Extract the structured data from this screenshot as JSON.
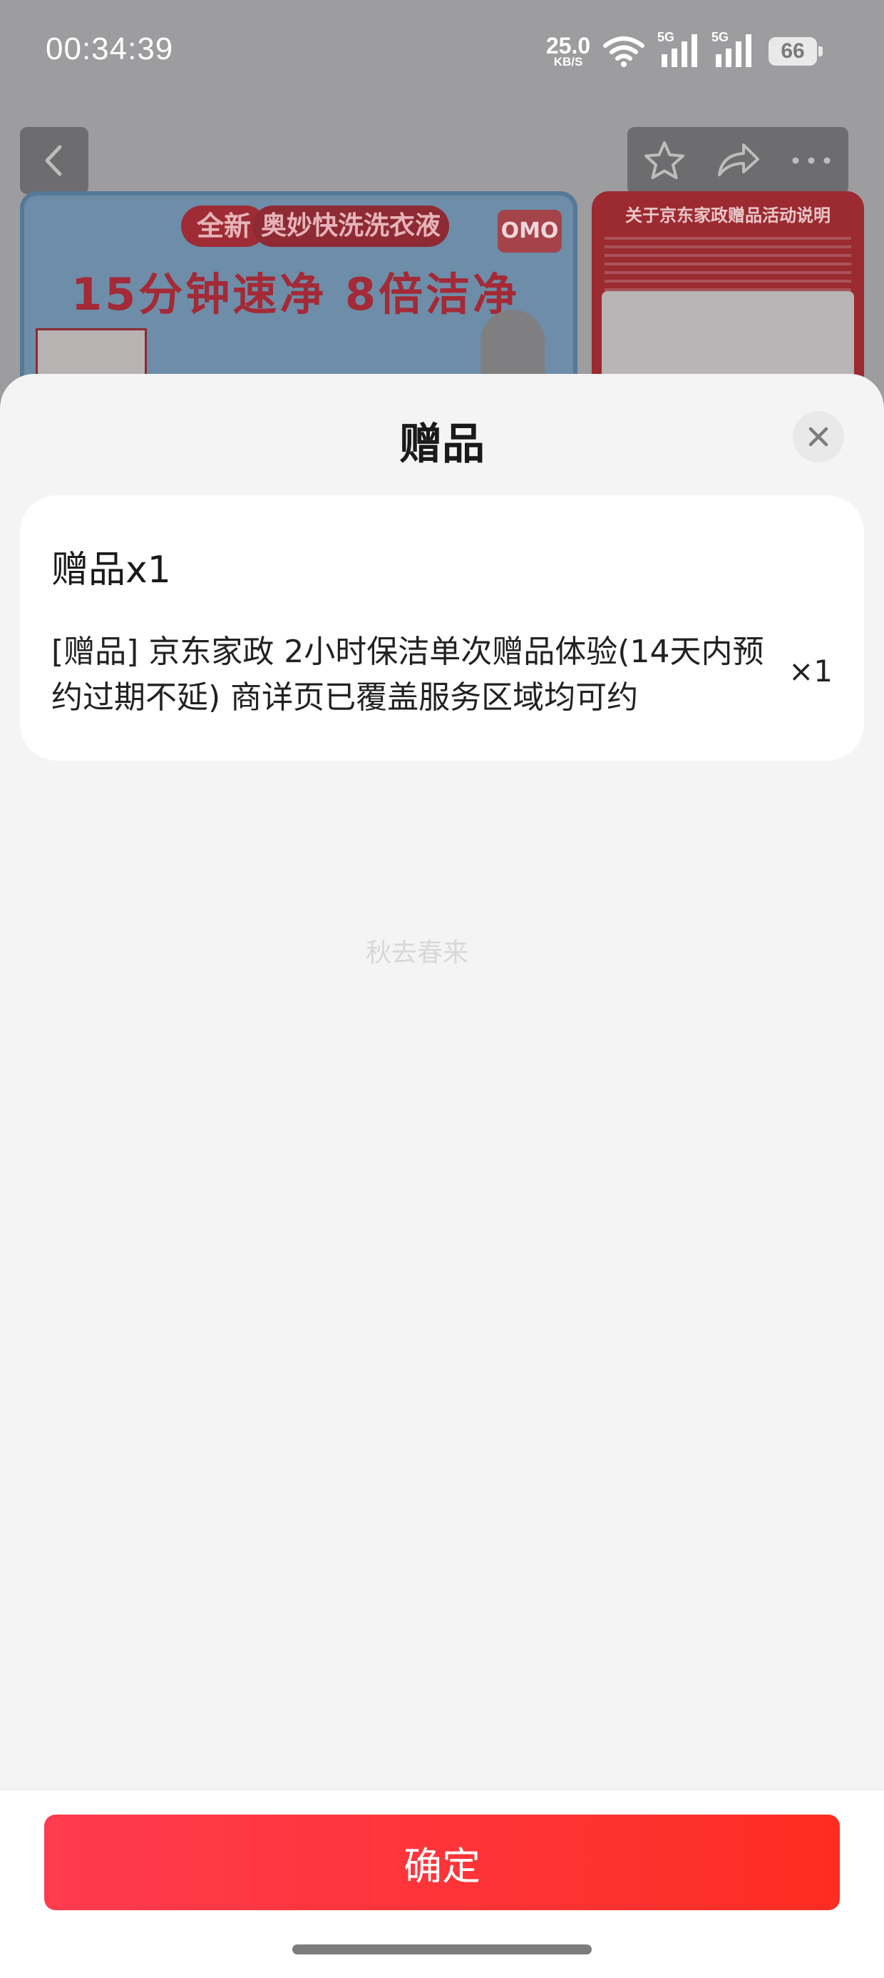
{
  "status_bar": {
    "time": "00:34:39",
    "net_speed": "25.0",
    "net_unit": "KB/S",
    "sim1_label": "5G",
    "sim2_label": "5G",
    "battery": "66"
  },
  "background_page": {
    "banner_main": {
      "tag_new": "全新",
      "product": "奥妙快洗洗衣液",
      "headline": "15分钟速净 8倍洁净力",
      "brand": "OMO"
    },
    "banner_side": {
      "title": "关于京东家政赠品活动说明"
    }
  },
  "sheet": {
    "title": "赠品",
    "gift": {
      "heading": "赠品x1",
      "description": "[赠品] 京东家政 2小时保洁单次赠品体验(14天内预约过期不延) 商详页已覆盖服务区域均可约",
      "quantity": "×1"
    },
    "watermark": "秋去春来",
    "confirm_label": "确定"
  },
  "colors": {
    "confirm_start": "#ff3b4f",
    "confirm_end": "#fe2d22"
  },
  "icons": [
    "back-icon",
    "star-icon",
    "share-icon",
    "more-icon",
    "close-icon",
    "wifi-icon",
    "signal-icon"
  ]
}
